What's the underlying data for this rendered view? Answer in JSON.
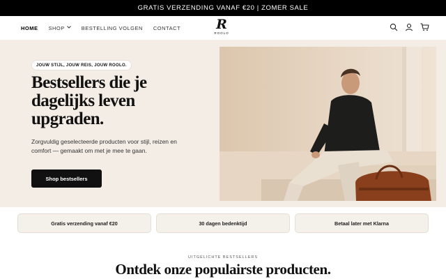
{
  "announcement": "GRATIS VERZENDING VANAF €20 | ZOMER SALE",
  "nav": {
    "home": "HOME",
    "shop": "SHOP",
    "bestelling": "BESTELLING VOLGEN",
    "contact": "CONTACT"
  },
  "logo": {
    "mark": "R",
    "word": "ROOLO"
  },
  "icons": [
    "search-icon",
    "account-icon",
    "cart-icon"
  ],
  "hero": {
    "pill": "JOUW STIJL, JOUW REIS, JOUW ROOLO.",
    "title": "Bestsellers die je dagelijks leven upgraden.",
    "subtitle": "Zorgvuldig geselecteerde producten voor stijl, reizen en comfort — gemaakt om met je mee te gaan.",
    "cta": "Shop bestsellers"
  },
  "usps": [
    "Gratis verzending vanaf €20",
    "30 dagen bedenktijd",
    "Betaal later met Klarna"
  ],
  "featured": {
    "eyebrow": "UITGELICHTE BESTSELLERS",
    "title": "Ontdek onze populairste producten."
  },
  "colors": {
    "announcement_bg": "#000000",
    "hero_bg": "#f4ede6",
    "cta_bg": "#111111",
    "usp_bg": "#f4f0ea"
  }
}
